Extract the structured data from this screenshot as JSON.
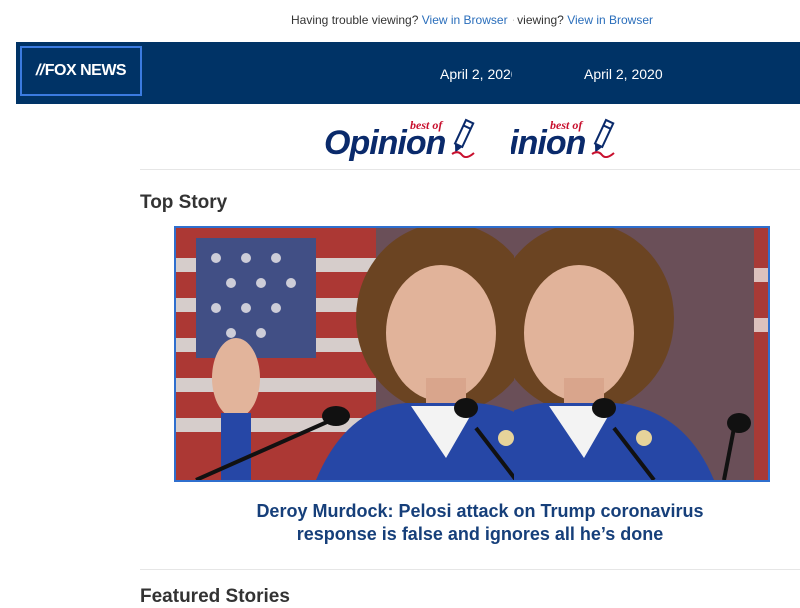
{
  "preheader": {
    "trouble_text": "Having trouble viewing? ",
    "link_label": "View in Browser"
  },
  "header": {
    "logo_text": "FOX NEWS",
    "date": "April 2, 2020"
  },
  "opinion_logo": {
    "best_of": "best of",
    "word": "Opinion"
  },
  "top_story": {
    "section_title": "Top Story",
    "headline_line1": "Deroy Murdock: Pelosi attack on Trump coronavirus",
    "headline_line2": "response is false and ignores all he’s done"
  },
  "featured": {
    "section_title": "Featured Stories"
  },
  "colors": {
    "header_bg": "#003366",
    "link": "#2a6ebb",
    "headline": "#163f7a",
    "accent_red": "#c8102e"
  }
}
